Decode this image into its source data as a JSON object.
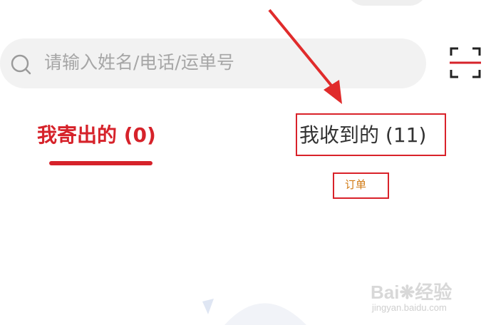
{
  "search": {
    "placeholder": "请输入姓名/电话/运单号",
    "icon": "search-icon"
  },
  "scan": {
    "icon": "scan-icon"
  },
  "tabs": [
    {
      "label": "我寄出的 (0)",
      "active": true
    },
    {
      "label": "我收到的 (11)",
      "active": false
    }
  ],
  "annotation": {
    "label": "订单"
  },
  "watermark": {
    "main": "Bai",
    "main2": "经验",
    "sub": "jingyan.baidu.com"
  },
  "colors": {
    "accent": "#d6222a",
    "annotation_text": "#d17a14"
  }
}
